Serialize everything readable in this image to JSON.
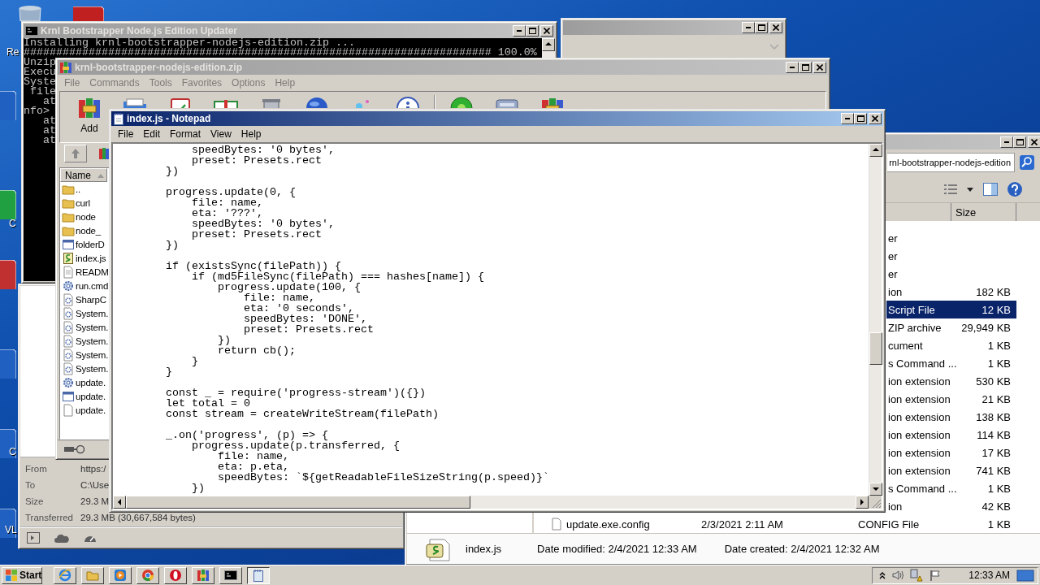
{
  "desktop_labels": [
    "Re",
    "C",
    "C",
    "VL"
  ],
  "console": {
    "title": "Krnl Bootstrapper Node.js Edition Updater",
    "active": false,
    "lines": [
      "Installing krnl-bootstrapper-nodejs-edition.zip ...",
      "######################################################################## 100.0%",
      "Unzip",
      "Execu",
      "Syste",
      " file",
      "   at",
      "nfo>",
      "   at",
      "   at",
      "   at"
    ]
  },
  "download_dialog": {
    "fields": [
      {
        "label": "From",
        "value": "https:/"
      },
      {
        "label": "To",
        "value": "C:\\Use"
      },
      {
        "label": "Size",
        "value": "29.3 M"
      },
      {
        "label": "Transferred",
        "value": "29.3 MB (30,667,584 bytes)"
      }
    ]
  },
  "explorer": {
    "active": false,
    "address": "rnl-bootstrapper-nodejs-edition",
    "size_column": "Size",
    "rows": [
      {
        "type": "er",
        "selected": false
      },
      {
        "type": "er",
        "selected": false
      },
      {
        "type": "er",
        "selected": false
      },
      {
        "type": "ion",
        "size": "182 KB",
        "selected": false
      },
      {
        "type": "Script File",
        "size": "12 KB",
        "selected": true
      },
      {
        "type": "ZIP archive",
        "size": "29,949 KB",
        "selected": false
      },
      {
        "type": "cument",
        "size": "1 KB",
        "selected": false
      },
      {
        "type": "s Command ...",
        "size": "1 KB",
        "selected": false
      },
      {
        "type": "ion extension",
        "size": "530 KB",
        "selected": false
      },
      {
        "type": "ion extension",
        "size": "21 KB",
        "selected": false
      },
      {
        "type": "ion extension",
        "size": "138 KB",
        "selected": false
      },
      {
        "type": "ion extension",
        "size": "114 KB",
        "selected": false
      },
      {
        "type": "ion extension",
        "size": "17 KB",
        "selected": false
      },
      {
        "type": "ion extension",
        "size": "741 KB",
        "selected": false
      },
      {
        "type": "s Command ...",
        "size": "1 KB",
        "selected": false
      },
      {
        "type": "ion",
        "size": "42 KB",
        "selected": false
      },
      {
        "name": "update.exe.config",
        "date": "2/3/2021 2:11 AM",
        "type": "CONFIG File",
        "size": "1 KB",
        "selected": false
      }
    ],
    "details": {
      "name": "index.js",
      "modified": "Date modified: 2/4/2021 12:33 AM",
      "created": "Date created: 2/4/2021 12:32 AM"
    }
  },
  "winrar": {
    "title": "krnl-bootstrapper-nodejs-edition.zip",
    "active": false,
    "menu": [
      {
        "label": "File",
        "disabled": true
      },
      {
        "label": "Commands",
        "disabled": true
      },
      {
        "label": "Tools",
        "disabled": true
      },
      {
        "label": "Favorites",
        "disabled": true
      },
      {
        "label": "Options",
        "disabled": true
      },
      {
        "label": "Help",
        "disabled": true
      }
    ],
    "toolbar": [
      {
        "kind": "archive",
        "label": "Add"
      },
      {
        "kind": "folder"
      },
      {
        "kind": "clipboard"
      },
      {
        "kind": "book"
      },
      {
        "kind": "trash"
      },
      {
        "kind": "globe"
      },
      {
        "kind": "sparkle"
      },
      {
        "kind": "info"
      },
      {
        "kind": "bug"
      },
      {
        "kind": "monitor"
      },
      {
        "kind": "archive"
      }
    ],
    "name_column": "Name",
    "files": [
      {
        "name": "..",
        "kind": "folder"
      },
      {
        "name": "curl",
        "kind": "folder"
      },
      {
        "name": "node",
        "kind": "folder"
      },
      {
        "name": "node_",
        "kind": "folder"
      },
      {
        "name": "folderD",
        "kind": "app"
      },
      {
        "name": "index.js",
        "kind": "script"
      },
      {
        "name": "READM",
        "kind": "text"
      },
      {
        "name": "run.cmd",
        "kind": "batch"
      },
      {
        "name": "SharpC",
        "kind": "dll"
      },
      {
        "name": "System.",
        "kind": "dll"
      },
      {
        "name": "System.",
        "kind": "dll"
      },
      {
        "name": "System.",
        "kind": "dll"
      },
      {
        "name": "System.",
        "kind": "dll"
      },
      {
        "name": "System.",
        "kind": "dll"
      },
      {
        "name": "update.",
        "kind": "batch"
      },
      {
        "name": "update.",
        "kind": "app"
      },
      {
        "name": "update.",
        "kind": "file"
      }
    ]
  },
  "notepad": {
    "title": "index.js - Notepad",
    "active": true,
    "menu": [
      {
        "label": "File",
        "disabled": false
      },
      {
        "label": "Edit",
        "disabled": false
      },
      {
        "label": "Format",
        "disabled": false
      },
      {
        "label": "View",
        "disabled": false
      },
      {
        "label": "Help",
        "disabled": false
      }
    ],
    "blocks": [
      [
        "            speedBytes: '0 bytes',",
        "            preset: Presets.rect",
        "        })"
      ],
      [
        "        progress.update(0, {",
        "            file: name,",
        "            eta: '???',",
        "            speedBytes: '0 bytes',",
        "            preset: Presets.rect",
        "        })"
      ],
      [
        "        if (existsSync(filePath)) {",
        "            if (md5FileSync(filePath) === hashes[name]) {",
        "                progress.update(100, {",
        "                    file: name,",
        "                    eta: '0 seconds',",
        "                    speedBytes: 'DONE',",
        "                    preset: Presets.rect",
        "                })",
        "                return cb();",
        "            }",
        "        }"
      ],
      [
        "        const _ = require('progress-stream')({})",
        "        let total = 0",
        "        const stream = createWriteStream(filePath)"
      ],
      [
        "        _.on('progress', (p) => {",
        "            progress.update(p.transferred, {",
        "                file: name,",
        "                eta: p.eta,",
        "                speedBytes: `${getReadableFileSizeString(p.speed)}`",
        "            })"
      ]
    ]
  },
  "taskbar": {
    "start": "Start",
    "apps": [
      {
        "kind": "ie",
        "selected": false
      },
      {
        "kind": "folder",
        "selected": false
      },
      {
        "kind": "media",
        "selected": false
      },
      {
        "kind": "chrome",
        "selected": false
      },
      {
        "kind": "opera",
        "selected": false
      },
      {
        "kind": "winrar",
        "selected": false
      },
      {
        "kind": "console",
        "selected": false
      },
      {
        "kind": "notepad",
        "selected": true
      }
    ],
    "clock": "12:33 AM"
  }
}
